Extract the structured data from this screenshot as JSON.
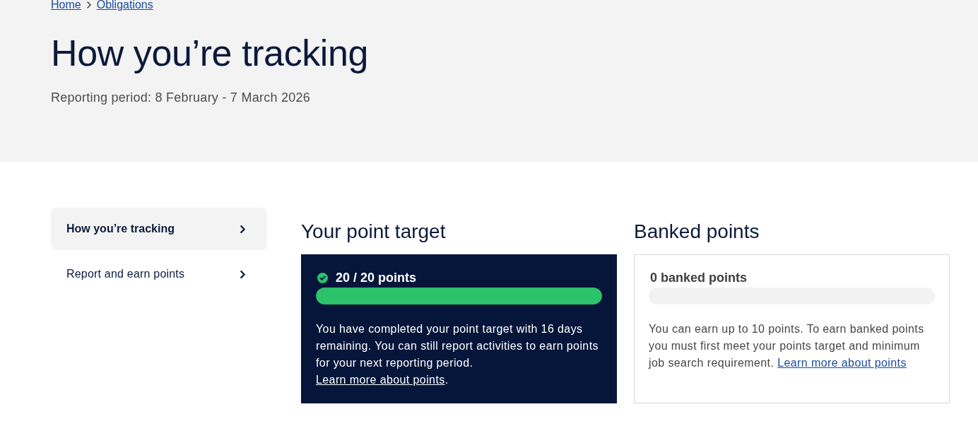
{
  "breadcrumb": [
    {
      "label": "Home"
    },
    {
      "label": "Obligations"
    }
  ],
  "header": {
    "title": "How you’re tracking",
    "reporting_period": "Reporting period: 8 February - 7 March 2026"
  },
  "sidebar": {
    "items": [
      {
        "label": "How you’re tracking",
        "selected": true
      },
      {
        "label": "Report and earn points",
        "selected": false
      }
    ]
  },
  "cards": [
    {
      "kind": "dark",
      "heading": "Your point target",
      "completed": true,
      "points_label": "20 / 20 points",
      "level": 1,
      "text": "You have completed your point target with 16 days remaining. You can still report activities to earn points for your next reporting period.",
      "link": "Learn more about points",
      "link_on_own_line": true,
      "after_link": "."
    },
    {
      "kind": "outline",
      "heading": "Banked points",
      "completed": false,
      "points_label": "0 banked points",
      "level": 0,
      "text": "You can earn up to 10 points. To earn banked points you must first meet your points target and minimum job search requirement.",
      "link": "Learn more about points",
      "link_on_own_line": false
    }
  ]
}
